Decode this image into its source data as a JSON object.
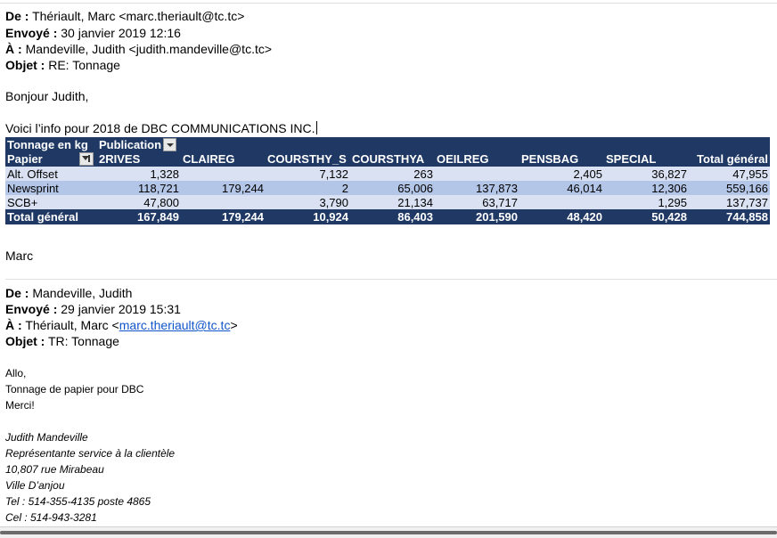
{
  "reply": {
    "from_label": "De :",
    "from_value": "Thériault, Marc <marc.theriault@tc.tc>",
    "sent_label": "Envoyé :",
    "sent_value": "30 janvier 2019 12:16",
    "to_label": "À :",
    "to_value": "Mandeville, Judith <judith.mandeville@tc.tc>",
    "subject_label": "Objet :",
    "subject_value": "RE: Tonnage",
    "greeting": "Bonjour Judith,",
    "intro": "Voici l’info pour 2018 de DBC COMMUNICATIONS INC.",
    "signoff": "Marc"
  },
  "pivot": {
    "corner_label": "Tonnage en kg",
    "column_field_label": "Publication",
    "row_field_label": "Papier",
    "columns": [
      "2RIVES",
      "CLAIREG",
      "COURSTHY_S",
      "COURSTHYA",
      "OEILREG",
      "PENSBAG",
      "SPECIAL",
      "Total général"
    ],
    "rows": [
      {
        "label": "Alt. Offset",
        "values": [
          "1,328",
          "",
          "7,132",
          "263",
          "",
          "2,405",
          "36,827",
          "47,955"
        ]
      },
      {
        "label": "Newsprint",
        "values": [
          "118,721",
          "179,244",
          "2",
          "65,006",
          "137,873",
          "46,014",
          "12,306",
          "559,166"
        ]
      },
      {
        "label": "SCB+",
        "values": [
          "47,800",
          "",
          "3,790",
          "21,134",
          "63,717",
          "",
          "1,295",
          "137,737"
        ]
      }
    ],
    "total": {
      "label": "Total général",
      "values": [
        "167,849",
        "179,244",
        "10,924",
        "86,403",
        "201,590",
        "48,420",
        "50,428",
        "744,858"
      ]
    }
  },
  "original": {
    "from_label": "De :",
    "from_value": "Mandeville, Judith",
    "sent_label": "Envoyé :",
    "sent_value": "29 janvier 2019 15:31",
    "to_label": "À :",
    "to_prefix": "Thériault, Marc <",
    "to_link": "marc.theriault@tc.tc",
    "to_suffix": ">",
    "subject_label": "Objet :",
    "subject_value": "TR: Tonnage",
    "line1": "Allo,",
    "line2": "Tonnage de papier pour DBC",
    "line3": "Merci!",
    "sig_name": "Judith Mandeville",
    "sig_title": "Représentante service à la clientèle",
    "sig_address": "10,807 rue Mirabeau",
    "sig_city": "Ville D’anjou",
    "sig_tel": "Tel : 514-355-4135 poste 4865",
    "sig_cel": "Cel : 514-943-3281"
  },
  "colors": {
    "header_dark": "#1f3864",
    "row_light": "#b4c6e7",
    "row_lighter": "#d9e1f2",
    "link": "#1155cc"
  }
}
